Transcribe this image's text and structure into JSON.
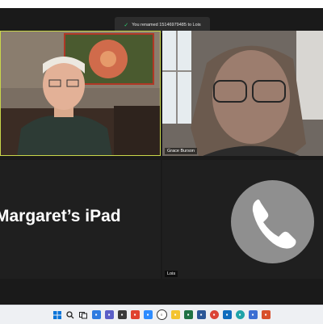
{
  "notification": {
    "text": "You renamed 15146979485 to Lois"
  },
  "participants": [
    {
      "name": ""
    },
    {
      "name": "Grace Burson"
    },
    {
      "name": "Margaret’s iPad"
    },
    {
      "name": "Lois"
    }
  ],
  "colors": {
    "active_speaker_border": "#c9d64a",
    "toast_check": "#2ecc71",
    "avatar_circle": "#8f8f8f"
  },
  "taskbar": {
    "icons": [
      "windows-start-icon",
      "search-icon",
      "task-view-icon",
      "widgets-icon",
      "teams-chat-icon",
      "store-icon",
      "office-icon",
      "zoom-icon",
      "dell-icon",
      "file-explorer-icon",
      "excel-icon",
      "word-icon",
      "chrome-icon",
      "outlook-icon",
      "edge-icon",
      "store-bag-icon",
      "another-app-icon"
    ]
  }
}
